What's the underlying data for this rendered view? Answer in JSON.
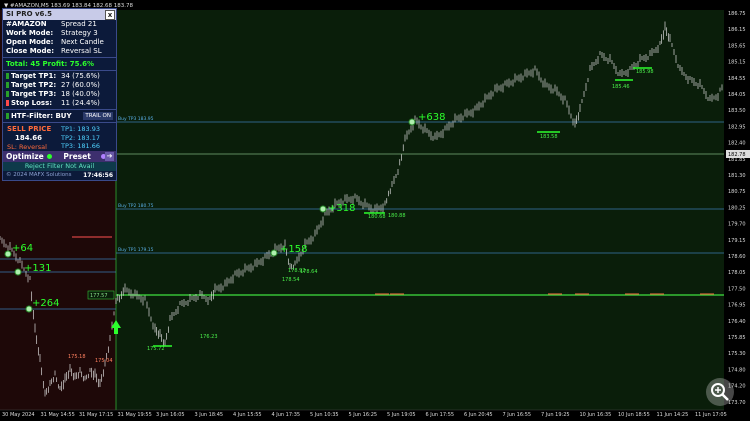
{
  "window_title": "▼ #AMAZON,M5  183.69 183.84 182.68 183.78",
  "panel": {
    "header": "SI PRO v6.5",
    "close": "x",
    "rows": [
      {
        "label": "#AMAZON",
        "value": "Spread 21"
      },
      {
        "label": "Work Mode:",
        "value": "Strategy 3"
      },
      {
        "label": "Open Mode:",
        "value": "Next Candle"
      },
      {
        "label": "Close Mode:",
        "value": "Reversal SL"
      }
    ],
    "total": "Total: 45  Profit: 75.6%",
    "targets": [
      {
        "label": "Target TP1:",
        "value": "34 (75.6%)"
      },
      {
        "label": "Target TP2:",
        "value": "27 (60.0%)"
      },
      {
        "label": "Target TP3:",
        "value": "18 (40.0%)"
      },
      {
        "label": "Stop Loss:",
        "value": "11 (24.4%)"
      }
    ],
    "htf": "HTF-Filter: BUY",
    "trail": "TRAIL ON",
    "sell_label": "SELL PRICE",
    "sell_price": "184.66",
    "sl_text": "SL: Reversal",
    "tps": [
      "TP1: 183.93",
      "TP2: 183.17",
      "TP3: 181.66"
    ],
    "optimize": "Optimize",
    "preset": "Preset",
    "reject": "Reject Filter Not Avail",
    "copyright": "© 2024 MAFX Solutions",
    "time": "17:46:56"
  },
  "price_scale": [
    "186.75",
    "186.15",
    "185.65",
    "185.15",
    "184.55",
    "184.05",
    "183.50",
    "182.95",
    "182.40",
    "181.85",
    "181.30",
    "180.75",
    "180.25",
    "179.70",
    "179.15",
    "178.60",
    "178.05",
    "177.50",
    "176.95",
    "176.40",
    "175.85",
    "175.30",
    "174.80",
    "174.20",
    "173.70"
  ],
  "current_price": "182.78",
  "time_axis": [
    "30 May 2024",
    "31 May 14:55",
    "31 May 17:15",
    "31 May 19:55",
    "3 Jun 16:05",
    "3 Jun 18:45",
    "4 Jun 15:55",
    "4 Jun 17:35",
    "5 Jun 10:35",
    "5 Jun 16:25",
    "5 Jun 19:05",
    "6 Jun 17:55",
    "6 Jun 20:45",
    "7 Jun 16:55",
    "7 Jun 19:25",
    "10 Jun 16:35",
    "10 Jun 18:55",
    "11 Jun 14:25",
    "11 Jun 17:05"
  ],
  "level_labels": {
    "tp3": "Buy TP3 183.95",
    "tp2": "Buy TP2 180.75",
    "tp1": "Buy TP1 179.15",
    "entry": "177.57"
  },
  "pips": [
    "+638",
    "+318",
    "+158",
    "+64",
    "+131",
    "+264"
  ],
  "small_labels": [
    "183.58",
    "185.46",
    "185.98",
    "180.68",
    "180.88",
    "178.54",
    "178.64",
    "178.92",
    "175.72",
    "176.23",
    "175.18",
    "175.04"
  ],
  "colors": {
    "background": "#000000",
    "buy_zone": "#0a1e0a",
    "sell_zone": "#1e0808",
    "level_line": "#3a7ab0",
    "green": "#2cff2c",
    "red": "#ff5050"
  }
}
